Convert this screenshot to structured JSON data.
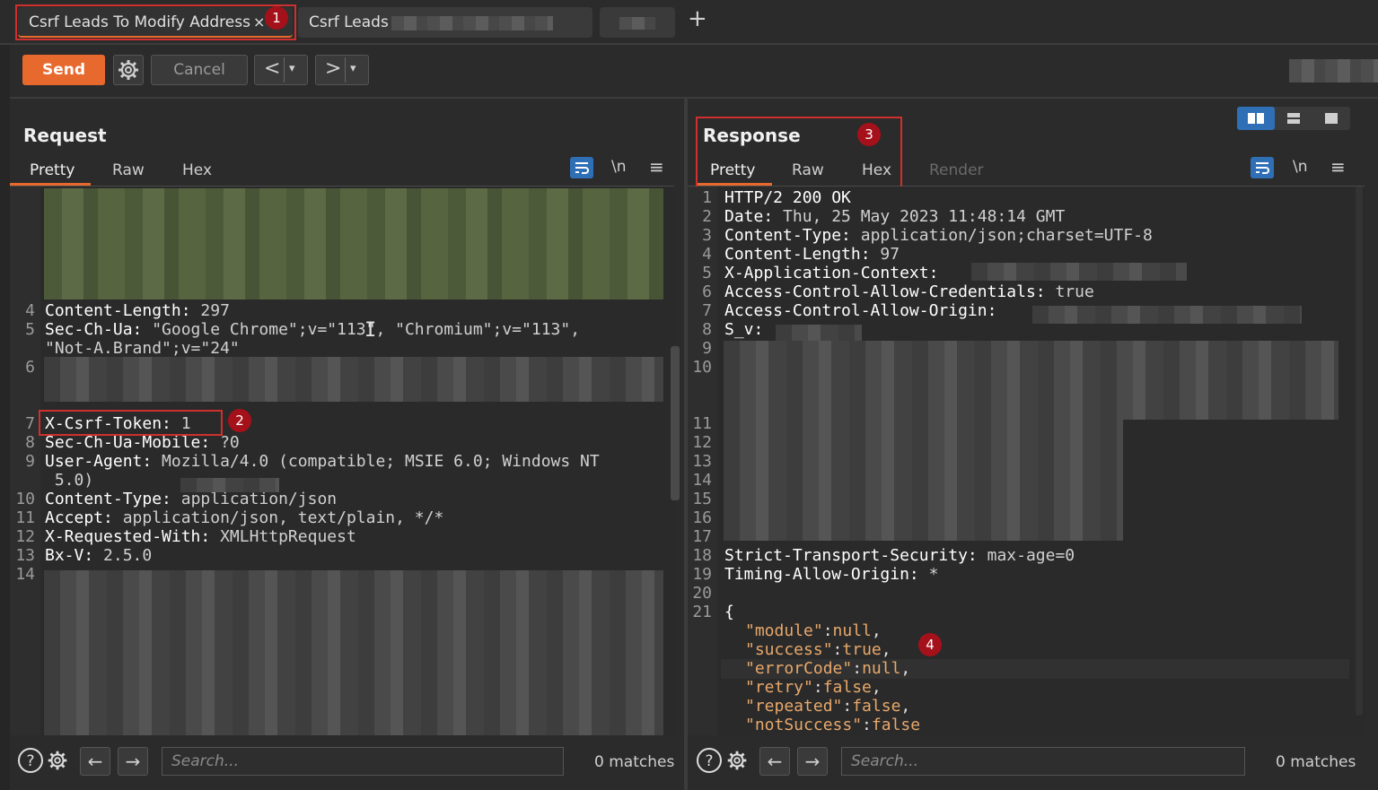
{
  "tabs": [
    {
      "label": "Csrf Leads To Modify Address",
      "close": "×",
      "active": true
    },
    {
      "label": "Csrf  Leads",
      "active": false
    }
  ],
  "new_tab_label": "+",
  "toolbar": {
    "send_label": "Send",
    "cancel_label": "Cancel",
    "back_label": "<",
    "forward_label": ">",
    "dropdown_glyph": "▾"
  },
  "request": {
    "title": "Request",
    "tabs": [
      "Pretty",
      "Raw",
      "Hex"
    ],
    "wrap_label": "\\n",
    "lines": [
      {
        "n": "4",
        "key": "Content-Length:",
        "val": " 297"
      },
      {
        "n": "5",
        "key": "Sec-Ch-Ua:",
        "val": " \"Google Chrome\";v=\"113\", \"Chromium\";v=\"113\","
      },
      {
        "n": "",
        "key": "",
        "val": "\"Not-A.Brand\";v=\"24\""
      },
      {
        "n": "6",
        "key": "",
        "val": ""
      },
      {
        "n": "7",
        "key": "X-Csrf-Token:",
        "val": " 1"
      },
      {
        "n": "8",
        "key": "Sec-Ch-Ua-Mobile:",
        "val": " ?0"
      },
      {
        "n": "9",
        "key": "User-Agent:",
        "val": " Mozilla/4.0 (compatible; MSIE 6.0; Windows NT"
      },
      {
        "n": "",
        "key": "",
        "val": " 5.0)"
      },
      {
        "n": "10",
        "key": "Content-Type:",
        "val": " application/json"
      },
      {
        "n": "11",
        "key": "Accept:",
        "val": " application/json, text/plain, */*"
      },
      {
        "n": "12",
        "key": "X-Requested-With:",
        "val": " XMLHttpRequest"
      },
      {
        "n": "13",
        "key": "Bx-V:",
        "val": " 2.5.0"
      },
      {
        "n": "14",
        "key": "",
        "val": ""
      }
    ],
    "search_placeholder": "Search...",
    "matches": "0 matches"
  },
  "response": {
    "title": "Response",
    "tabs": [
      "Pretty",
      "Raw",
      "Hex",
      "Render"
    ],
    "wrap_label": "\\n",
    "lines": [
      {
        "n": "1",
        "key": "HTTP/2 200 OK",
        "val": ""
      },
      {
        "n": "2",
        "key": "Date:",
        "val": " Thu, 25 May 2023 11:48:14 GMT"
      },
      {
        "n": "3",
        "key": "Content-Type:",
        "val": " application/json;charset=UTF-8"
      },
      {
        "n": "4",
        "key": "Content-Length:",
        "val": " 97"
      },
      {
        "n": "5",
        "key": "X-Application-Context:",
        "val": ""
      },
      {
        "n": "6",
        "key": "Access-Control-Allow-Credentials:",
        "val": " true"
      },
      {
        "n": "7",
        "key": "Access-Control-Allow-Origin:",
        "val": ""
      },
      {
        "n": "8",
        "key": "S_v:",
        "val": ""
      },
      {
        "n": "9",
        "key": "",
        "val": ""
      },
      {
        "n": "10",
        "key": "",
        "val": ""
      },
      {
        "n": "11",
        "key": "",
        "val": ""
      },
      {
        "n": "12",
        "key": "",
        "val": ""
      },
      {
        "n": "13",
        "key": "",
        "val": ""
      },
      {
        "n": "14",
        "key": "",
        "val": ""
      },
      {
        "n": "15",
        "key": "",
        "val": ""
      },
      {
        "n": "16",
        "key": "",
        "val": ""
      },
      {
        "n": "17",
        "key": "",
        "val": ""
      },
      {
        "n": "18",
        "key": "Strict-Transport-Security:",
        "val": " max-age=0"
      },
      {
        "n": "19",
        "key": "Timing-Allow-Origin:",
        "val": " *"
      },
      {
        "n": "20",
        "key": "",
        "val": ""
      },
      {
        "n": "21",
        "key": "{",
        "val": ""
      }
    ],
    "json": [
      {
        "k": "\"module\"",
        "v": "null",
        "end": ","
      },
      {
        "k": "\"success\"",
        "v": "true",
        "end": ","
      },
      {
        "k": "\"errorCode\"",
        "v": "null",
        "end": ","
      },
      {
        "k": "\"retry\"",
        "v": "false",
        "end": ","
      },
      {
        "k": "\"repeated\"",
        "v": "false",
        "end": ","
      },
      {
        "k": "\"notSuccess\"",
        "v": "false",
        "end": ""
      }
    ],
    "search_placeholder": "Search...",
    "matches": "0 matches"
  },
  "annotations": [
    "1",
    "2",
    "3",
    "4"
  ],
  "colors": {
    "accent": "#e8692e",
    "annotation": "#d0302d",
    "badge": "#a5111a",
    "active_icon": "#2f6fb5"
  }
}
